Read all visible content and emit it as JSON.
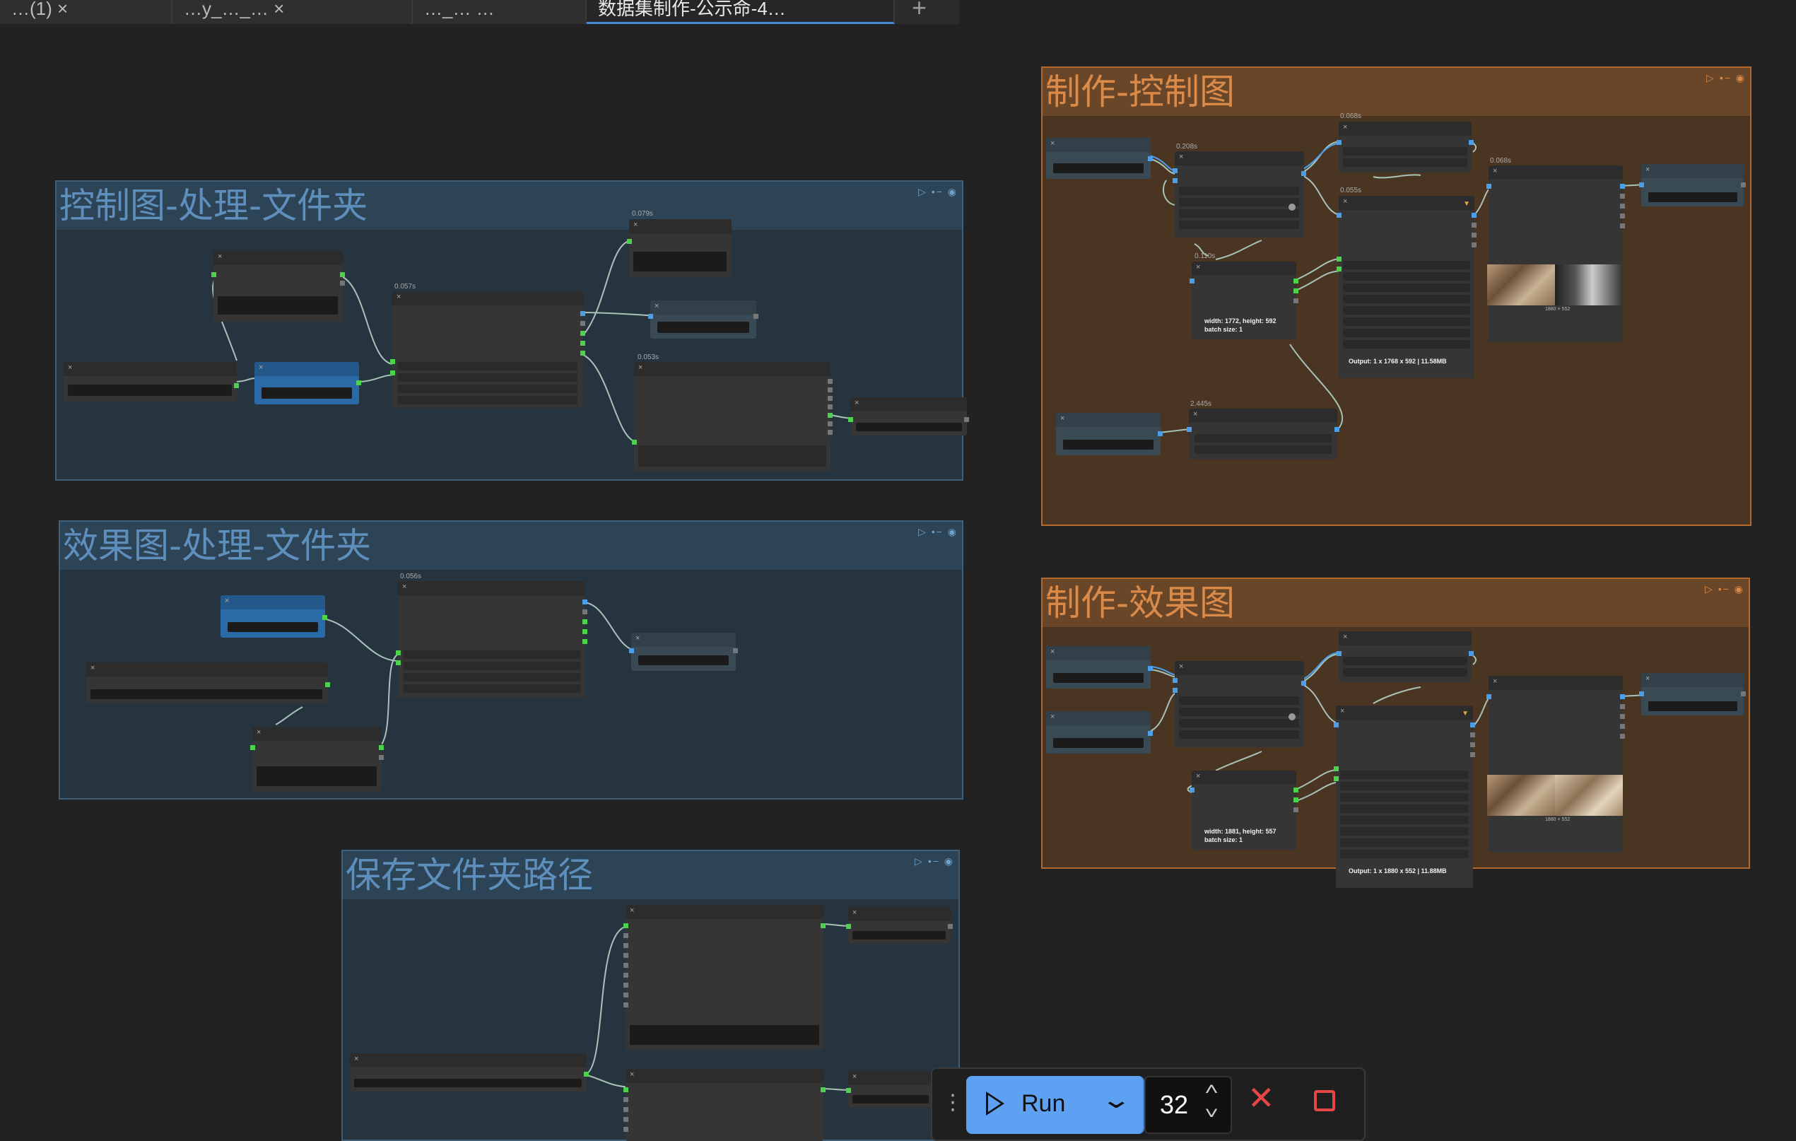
{
  "tabs": [
    {
      "label": "…(1) ×"
    },
    {
      "label": "…y_…_… ×"
    },
    {
      "label": "…_… …"
    },
    {
      "label": "数据集制作-公示命-4…",
      "active": true
    }
  ],
  "tab_add": "+",
  "groups": {
    "control_process": {
      "title": "控制图-处理-文件夹"
    },
    "effect_process": {
      "title": "效果图-处理-文件夹"
    },
    "save_path": {
      "title": "保存文件夹路径"
    },
    "make_control": {
      "title": "制作-控制图"
    },
    "make_effect": {
      "title": "制作-效果图"
    }
  },
  "group_icons": "▷ •− ◉",
  "times": {
    "cp_a": "0.057s",
    "cp_b": "0.079s",
    "cp_c": "0.053s",
    "ep_a": "0.056s",
    "mc_a": "0.208s",
    "mc_b": "0.068s",
    "mc_c": "0.055s",
    "mc_d": "0.068s",
    "mc_e": "0.110s",
    "mc_f": "2.445s"
  },
  "node_text": {
    "mc_size": "width: 1772, height: 592\nbatch size: 1",
    "mc_output": "Output: 1 x 1768 x 592 | 11.58MB",
    "mc_thumb": "1880 × 552",
    "me_size": "width: 1881, height: 557\nbatch size: 1",
    "me_output": "Output: 1 x 1880 x 552 | 11.88MB",
    "me_thumb": "1880 × 552"
  },
  "runbar": {
    "run_label": "Run",
    "count": "32"
  },
  "icons": {
    "play": "play-icon",
    "chevron": "chevron-down-icon",
    "cancel": "close-icon",
    "stop": "stop-icon",
    "drag": "drag-handle-icon"
  },
  "colors": {
    "blue_group": "#26343f",
    "brown_group": "#4a3523",
    "run_button": "#5ea0f2",
    "cancel": "#e54747"
  }
}
